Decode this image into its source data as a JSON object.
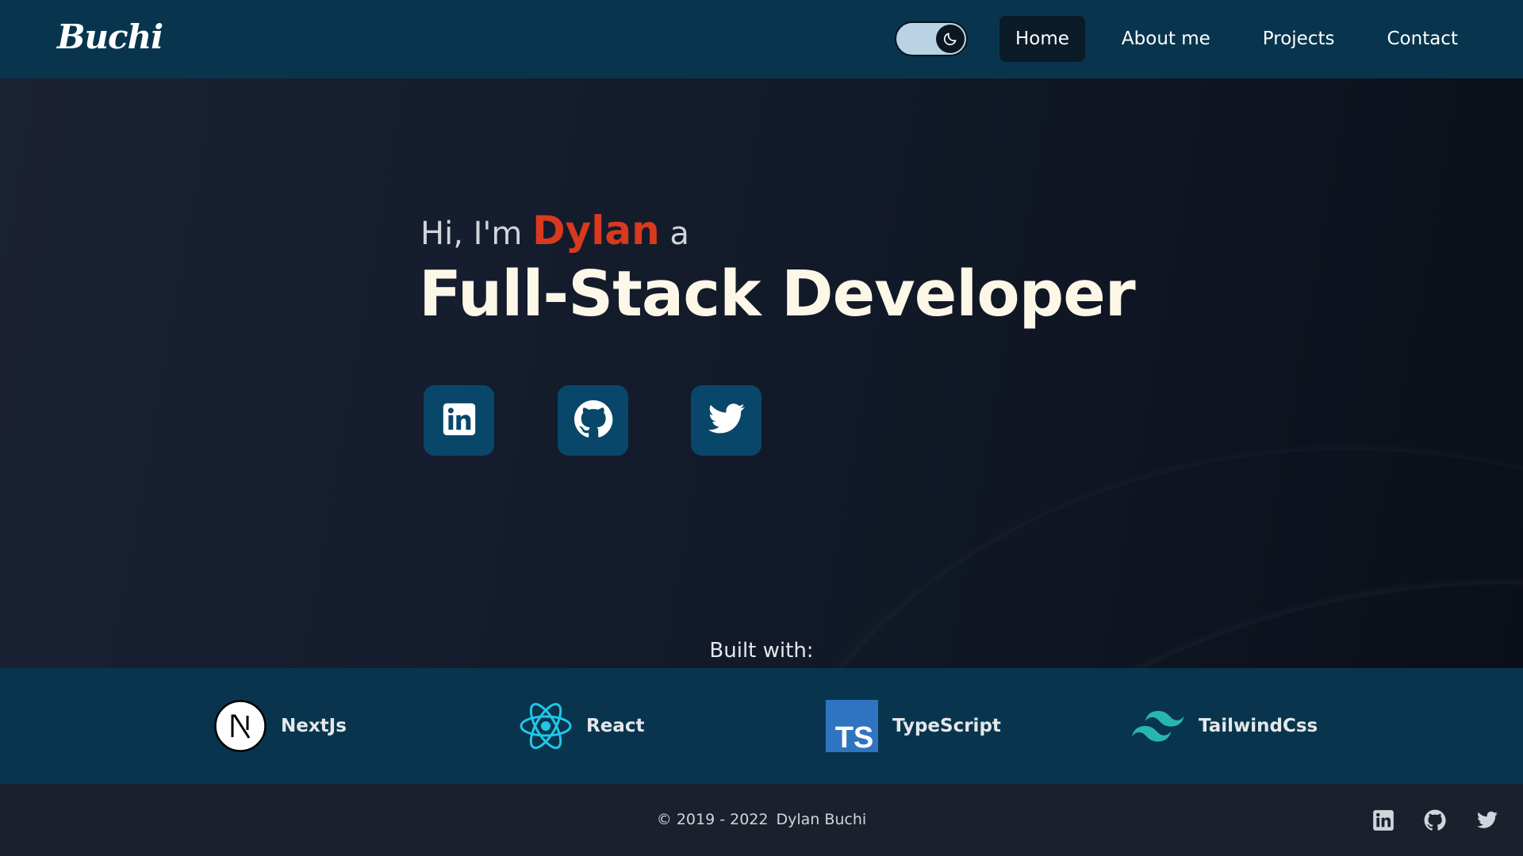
{
  "nav": {
    "brand": "Buchi",
    "theme_toggle": {
      "icon": "moon-icon",
      "state": "dark"
    },
    "links": [
      {
        "label": "Home",
        "active": true
      },
      {
        "label": "About me",
        "active": false
      },
      {
        "label": "Projects",
        "active": false
      },
      {
        "label": "Contact",
        "active": false
      }
    ]
  },
  "hero": {
    "greeting_prefix": "Hi, I'm",
    "name": "Dylan",
    "greeting_suffix": "a",
    "role": "Full-Stack Developer",
    "social": [
      {
        "name": "linkedin-icon"
      },
      {
        "name": "github-icon"
      },
      {
        "name": "twitter-icon"
      }
    ]
  },
  "built_with": {
    "label": "Built with:",
    "tech": [
      {
        "label": "NextJs",
        "icon": "nextjs-icon"
      },
      {
        "label": "React",
        "icon": "react-icon"
      },
      {
        "label": "TypeScript",
        "icon": "typescript-icon"
      },
      {
        "label": "TailwindCss",
        "icon": "tailwind-icon"
      }
    ]
  },
  "footer": {
    "copyright_years": "© 2019 - 2022",
    "copyright_name": "Dylan Buchi",
    "social": [
      {
        "name": "linkedin-icon"
      },
      {
        "name": "github-icon"
      },
      {
        "name": "twitter-icon"
      }
    ]
  },
  "colors": {
    "nav_bg": "#08354d",
    "accent_name": "#d9391e",
    "role_text": "#fdf7e7",
    "social_btn_bg": "#08476a",
    "footer_bg": "#1a212c"
  }
}
